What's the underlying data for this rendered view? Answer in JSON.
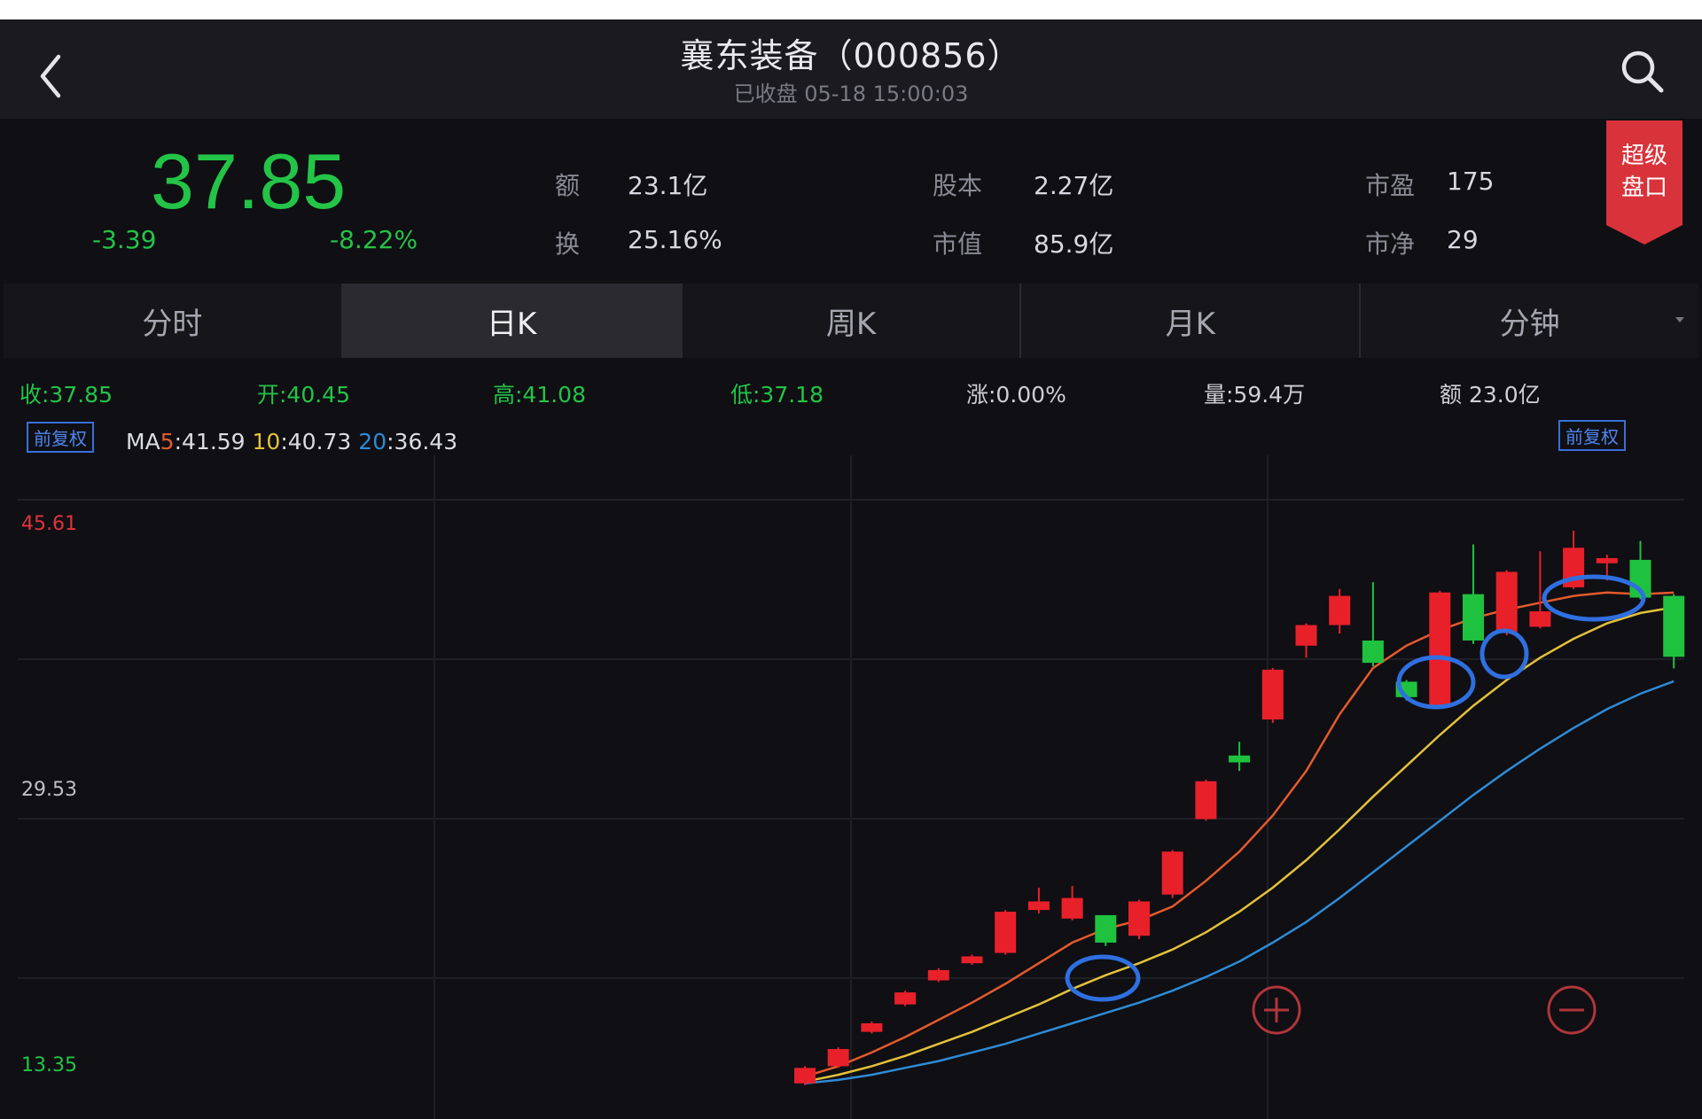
{
  "header": {
    "title": "襄东装备（000856）",
    "subtitle": "已收盘 05-18 15:00:03"
  },
  "quote": {
    "price": "37.85",
    "change": "-3.39",
    "change_pct": "-8.22%",
    "stats": [
      {
        "label": "额",
        "value": "23.1亿"
      },
      {
        "label": "换",
        "value": "25.16%"
      },
      {
        "label": "股本",
        "value": "2.27亿"
      },
      {
        "label": "市值",
        "value": "85.9亿"
      },
      {
        "label": "市盈",
        "value": "175"
      },
      {
        "label": "市净",
        "value": "29"
      }
    ],
    "badge": "超级盘口"
  },
  "tabs": [
    {
      "label": "分时",
      "active": false
    },
    {
      "label": "日K",
      "active": true
    },
    {
      "label": "周K",
      "active": false
    },
    {
      "label": "月K",
      "active": false
    },
    {
      "label": "分钟",
      "active": false
    }
  ],
  "ohlc": {
    "close": "收:37.85",
    "open": "开:40.45",
    "high": "高:41.08",
    "low": "低:37.18",
    "change": "涨:0.00%",
    "volume": "量:59.4万",
    "amount": "额 23.0亿"
  },
  "ma": {
    "prefix": "MA",
    "ma5_label": "5",
    "ma5_value": ":41.59",
    "ma10_label": "10",
    "ma10_value": ":40.73",
    "ma20_label": "20",
    "ma20_value": ":36.43"
  },
  "tags": {
    "left": "前复权",
    "right": "前复权"
  },
  "chart_data": {
    "type": "candlestick",
    "y_labels": [
      "45.61",
      "29.53",
      "13.35"
    ],
    "ylim": [
      13.35,
      45.61
    ],
    "candles": [
      {
        "o": 13.0,
        "c": 13.9,
        "h": 14.0,
        "l": 12.9
      },
      {
        "o": 14.0,
        "c": 15.0,
        "h": 15.1,
        "l": 13.9
      },
      {
        "o": 16.0,
        "c": 16.5,
        "h": 16.6,
        "l": 15.9
      },
      {
        "o": 17.6,
        "c": 18.3,
        "h": 18.4,
        "l": 17.5
      },
      {
        "o": 19.0,
        "c": 19.6,
        "h": 19.7,
        "l": 18.9
      },
      {
        "o": 20.0,
        "c": 20.4,
        "h": 20.5,
        "l": 19.9
      },
      {
        "o": 20.6,
        "c": 23.0,
        "h": 23.1,
        "l": 20.5
      },
      {
        "o": 23.1,
        "c": 23.6,
        "h": 24.4,
        "l": 22.9
      },
      {
        "o": 22.6,
        "c": 23.8,
        "h": 24.5,
        "l": 22.5
      },
      {
        "o": 22.8,
        "c": 21.2,
        "h": 22.8,
        "l": 21.0
      },
      {
        "o": 21.6,
        "c": 23.6,
        "h": 23.7,
        "l": 21.4
      },
      {
        "o": 24.0,
        "c": 26.5,
        "h": 26.6,
        "l": 23.8
      },
      {
        "o": 28.4,
        "c": 30.6,
        "h": 30.7,
        "l": 28.3
      },
      {
        "o": 32.1,
        "c": 31.7,
        "h": 32.9,
        "l": 31.2
      },
      {
        "o": 34.2,
        "c": 37.1,
        "h": 37.2,
        "l": 34.0
      },
      {
        "o": 38.5,
        "c": 39.7,
        "h": 39.8,
        "l": 37.8
      },
      {
        "o": 39.7,
        "c": 41.4,
        "h": 41.8,
        "l": 39.2
      },
      {
        "o": 38.8,
        "c": 37.5,
        "h": 42.2,
        "l": 37.3
      },
      {
        "o": 36.4,
        "c": 35.5,
        "h": 36.5,
        "l": 35.3
      },
      {
        "o": 35.0,
        "c": 41.6,
        "h": 41.7,
        "l": 34.9
      },
      {
        "o": 41.5,
        "c": 38.8,
        "h": 44.4,
        "l": 38.6
      },
      {
        "o": 39.3,
        "c": 42.8,
        "h": 42.9,
        "l": 39.1
      },
      {
        "o": 39.6,
        "c": 40.5,
        "h": 44.0,
        "l": 39.5
      },
      {
        "o": 41.9,
        "c": 44.2,
        "h": 45.2,
        "l": 41.8
      },
      {
        "o": 43.3,
        "c": 43.6,
        "h": 43.8,
        "l": 42.3
      },
      {
        "o": 43.5,
        "c": 41.3,
        "h": 44.6,
        "l": 41.2
      },
      {
        "o": 41.4,
        "c": 37.85,
        "h": 41.5,
        "l": 37.18
      }
    ],
    "ma5": [
      13.4,
      14.0,
      14.8,
      15.7,
      16.7,
      17.7,
      18.8,
      20.0,
      21.2,
      22.0,
      22.5,
      23.3,
      24.8,
      26.5,
      28.6,
      31.2,
      34.5,
      37.2,
      38.5,
      39.4,
      40.1,
      40.6,
      41.0,
      41.4,
      41.6,
      41.5,
      41.59
    ],
    "ma10": [
      13.1,
      13.5,
      14.0,
      14.6,
      15.3,
      16.0,
      16.8,
      17.6,
      18.5,
      19.3,
      20.0,
      20.8,
      21.8,
      23.0,
      24.4,
      26.0,
      27.8,
      29.7,
      31.5,
      33.3,
      35.0,
      36.5,
      37.8,
      38.9,
      39.8,
      40.4,
      40.73
    ],
    "ma20": [
      13.0,
      13.2,
      13.5,
      13.9,
      14.3,
      14.8,
      15.3,
      15.9,
      16.5,
      17.1,
      17.7,
      18.4,
      19.2,
      20.1,
      21.2,
      22.4,
      23.8,
      25.3,
      26.8,
      28.3,
      29.8,
      31.2,
      32.5,
      33.7,
      34.8,
      35.7,
      36.43
    ]
  },
  "colors": {
    "up": "#e8202a",
    "down": "#1fc23e",
    "ma5": "#e55a2c",
    "ma10": "#e3c13a",
    "ma20": "#2e8bd6",
    "highlight": "#2f6fe0"
  },
  "icons": {
    "back": "chevron-left-icon",
    "search": "search-icon",
    "zoom_in": "zoom-in-icon",
    "zoom_out": "zoom-out-icon"
  }
}
